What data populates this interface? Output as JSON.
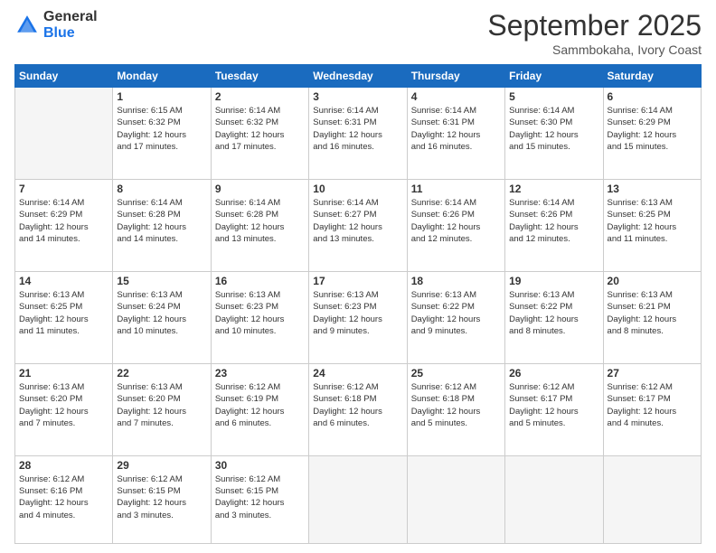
{
  "logo": {
    "general": "General",
    "blue": "Blue"
  },
  "header": {
    "month": "September 2025",
    "location": "Sammbokaha, Ivory Coast"
  },
  "days_of_week": [
    "Sunday",
    "Monday",
    "Tuesday",
    "Wednesday",
    "Thursday",
    "Friday",
    "Saturday"
  ],
  "weeks": [
    [
      {
        "day": "",
        "empty": true
      },
      {
        "day": "1",
        "sunrise": "6:15 AM",
        "sunset": "6:32 PM",
        "daylight": "12 hours and 17 minutes."
      },
      {
        "day": "2",
        "sunrise": "6:14 AM",
        "sunset": "6:32 PM",
        "daylight": "12 hours and 17 minutes."
      },
      {
        "day": "3",
        "sunrise": "6:14 AM",
        "sunset": "6:31 PM",
        "daylight": "12 hours and 16 minutes."
      },
      {
        "day": "4",
        "sunrise": "6:14 AM",
        "sunset": "6:31 PM",
        "daylight": "12 hours and 16 minutes."
      },
      {
        "day": "5",
        "sunrise": "6:14 AM",
        "sunset": "6:30 PM",
        "daylight": "12 hours and 15 minutes."
      },
      {
        "day": "6",
        "sunrise": "6:14 AM",
        "sunset": "6:29 PM",
        "daylight": "12 hours and 15 minutes."
      }
    ],
    [
      {
        "day": "7",
        "sunrise": "6:14 AM",
        "sunset": "6:29 PM",
        "daylight": "12 hours and 14 minutes."
      },
      {
        "day": "8",
        "sunrise": "6:14 AM",
        "sunset": "6:28 PM",
        "daylight": "12 hours and 14 minutes."
      },
      {
        "day": "9",
        "sunrise": "6:14 AM",
        "sunset": "6:28 PM",
        "daylight": "12 hours and 13 minutes."
      },
      {
        "day": "10",
        "sunrise": "6:14 AM",
        "sunset": "6:27 PM",
        "daylight": "12 hours and 13 minutes."
      },
      {
        "day": "11",
        "sunrise": "6:14 AM",
        "sunset": "6:26 PM",
        "daylight": "12 hours and 12 minutes."
      },
      {
        "day": "12",
        "sunrise": "6:14 AM",
        "sunset": "6:26 PM",
        "daylight": "12 hours and 12 minutes."
      },
      {
        "day": "13",
        "sunrise": "6:13 AM",
        "sunset": "6:25 PM",
        "daylight": "12 hours and 11 minutes."
      }
    ],
    [
      {
        "day": "14",
        "sunrise": "6:13 AM",
        "sunset": "6:25 PM",
        "daylight": "12 hours and 11 minutes."
      },
      {
        "day": "15",
        "sunrise": "6:13 AM",
        "sunset": "6:24 PM",
        "daylight": "12 hours and 10 minutes."
      },
      {
        "day": "16",
        "sunrise": "6:13 AM",
        "sunset": "6:23 PM",
        "daylight": "12 hours and 10 minutes."
      },
      {
        "day": "17",
        "sunrise": "6:13 AM",
        "sunset": "6:23 PM",
        "daylight": "12 hours and 9 minutes."
      },
      {
        "day": "18",
        "sunrise": "6:13 AM",
        "sunset": "6:22 PM",
        "daylight": "12 hours and 9 minutes."
      },
      {
        "day": "19",
        "sunrise": "6:13 AM",
        "sunset": "6:22 PM",
        "daylight": "12 hours and 8 minutes."
      },
      {
        "day": "20",
        "sunrise": "6:13 AM",
        "sunset": "6:21 PM",
        "daylight": "12 hours and 8 minutes."
      }
    ],
    [
      {
        "day": "21",
        "sunrise": "6:13 AM",
        "sunset": "6:20 PM",
        "daylight": "12 hours and 7 minutes."
      },
      {
        "day": "22",
        "sunrise": "6:13 AM",
        "sunset": "6:20 PM",
        "daylight": "12 hours and 7 minutes."
      },
      {
        "day": "23",
        "sunrise": "6:12 AM",
        "sunset": "6:19 PM",
        "daylight": "12 hours and 6 minutes."
      },
      {
        "day": "24",
        "sunrise": "6:12 AM",
        "sunset": "6:18 PM",
        "daylight": "12 hours and 6 minutes."
      },
      {
        "day": "25",
        "sunrise": "6:12 AM",
        "sunset": "6:18 PM",
        "daylight": "12 hours and 5 minutes."
      },
      {
        "day": "26",
        "sunrise": "6:12 AM",
        "sunset": "6:17 PM",
        "daylight": "12 hours and 5 minutes."
      },
      {
        "day": "27",
        "sunrise": "6:12 AM",
        "sunset": "6:17 PM",
        "daylight": "12 hours and 4 minutes."
      }
    ],
    [
      {
        "day": "28",
        "sunrise": "6:12 AM",
        "sunset": "6:16 PM",
        "daylight": "12 hours and 4 minutes."
      },
      {
        "day": "29",
        "sunrise": "6:12 AM",
        "sunset": "6:15 PM",
        "daylight": "12 hours and 3 minutes."
      },
      {
        "day": "30",
        "sunrise": "6:12 AM",
        "sunset": "6:15 PM",
        "daylight": "12 hours and 3 minutes."
      },
      {
        "day": "",
        "empty": true
      },
      {
        "day": "",
        "empty": true
      },
      {
        "day": "",
        "empty": true
      },
      {
        "day": "",
        "empty": true
      }
    ]
  ]
}
